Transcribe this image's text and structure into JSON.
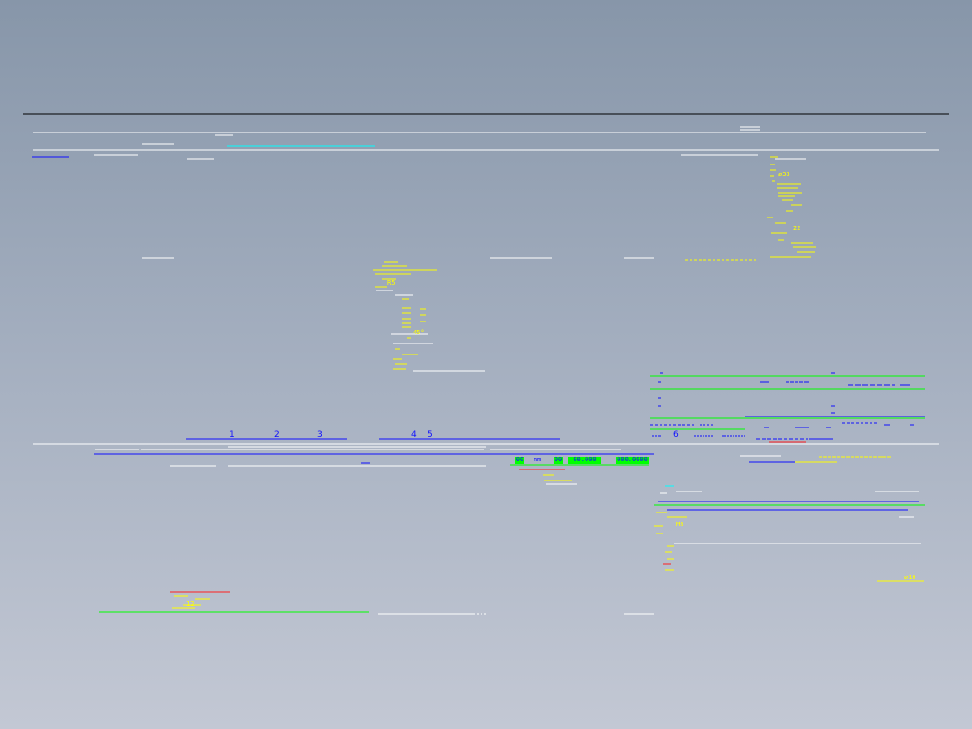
{
  "drawing": {
    "background_top": "#8796a9",
    "background_bottom": "#c3c8d4",
    "colors": {
      "frame": "#000000",
      "outline": "#ffffff",
      "centerline": "#00ffff",
      "dimension": "#ffff00",
      "section": "#1010ff",
      "hatch": "#00ff00",
      "cut": "#ff2020"
    }
  },
  "callouts": {
    "c1": "1",
    "c2": "2",
    "c3": "3",
    "c4": "4",
    "c5": "5",
    "c6": "6"
  },
  "scale_bar": {
    "cells": [
      "00",
      "mm",
      "00",
      "00.000",
      "000.0000"
    ]
  },
  "dimension_notes": {
    "d1": "ø38",
    "d2": "22",
    "d3": "R5",
    "d4": "45°",
    "d5": "M8",
    "d6": "ø16",
    "d7": "12"
  }
}
